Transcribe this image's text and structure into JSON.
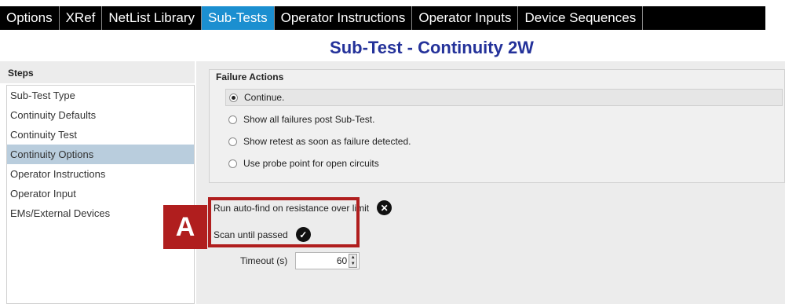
{
  "tabs": [
    {
      "label": "Options",
      "active": false
    },
    {
      "label": "XRef",
      "active": false
    },
    {
      "label": "NetList Library",
      "active": false
    },
    {
      "label": "Sub-Tests",
      "active": true
    },
    {
      "label": "Operator Instructions",
      "active": false
    },
    {
      "label": "Operator Inputs",
      "active": false
    },
    {
      "label": "Device Sequences",
      "active": false
    }
  ],
  "page_title": "Sub-Test - Continuity 2W",
  "steps": {
    "header": "Steps",
    "items": [
      "Sub-Test Type",
      "Continuity Defaults",
      "Continuity Test",
      "Continuity Options",
      "Operator Instructions",
      "Operator Input",
      "EMs/External Devices"
    ],
    "selected": "Continuity Options"
  },
  "failure_actions": {
    "title": "Failure Actions",
    "options": [
      "Continue.",
      "Show all failures post Sub-Test.",
      "Show retest as soon as failure detected.",
      "Use probe point for open circuits"
    ],
    "selected": "Continue."
  },
  "settings": {
    "auto_find_label": "Run auto-find on resistance over limit",
    "auto_find_icon": "x-circle-icon",
    "scan_until_passed_label": "Scan until passed",
    "scan_until_passed_icon": "check-circle-icon",
    "timeout_label": "Timeout (s)",
    "timeout_value": "60"
  },
  "callout": {
    "label": "A"
  },
  "colors": {
    "tab_active": "#1b8fd0",
    "title": "#24329a",
    "selection": "#b9cddd",
    "callout": "#b01e1e"
  }
}
